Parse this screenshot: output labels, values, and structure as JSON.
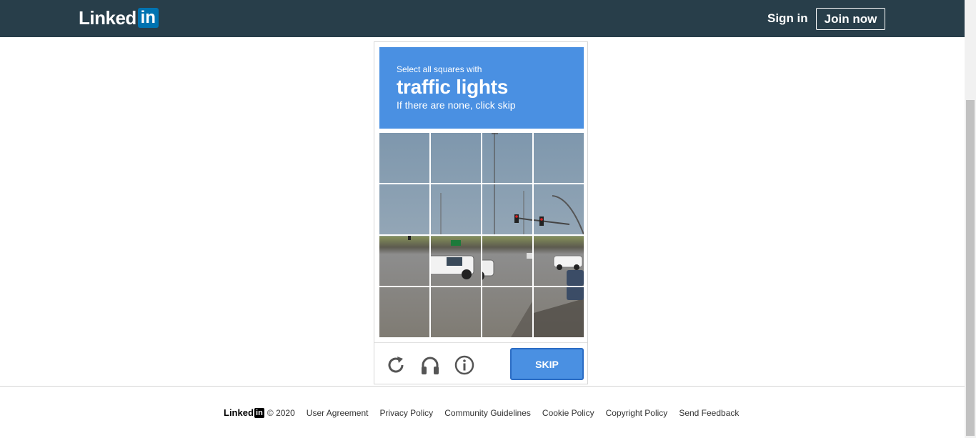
{
  "header": {
    "logo_text": "Linked",
    "logo_in": "in",
    "sign_in": "Sign in",
    "join_now": "Join now"
  },
  "captcha": {
    "instruction_line1": "Select all squares with",
    "target": "traffic lights",
    "instruction_line3": "If there are none, click skip",
    "skip_label": "SKIP",
    "icons": [
      "reload-icon",
      "audio-headphones-icon",
      "info-icon"
    ],
    "grid_rows": 4,
    "grid_cols": 4
  },
  "footer": {
    "logo_text": "Linked",
    "logo_in": "in",
    "copyright": "© 2020",
    "links": [
      "User Agreement",
      "Privacy Policy",
      "Community Guidelines",
      "Cookie Policy",
      "Copyright Policy",
      "Send Feedback"
    ]
  },
  "colors": {
    "header_bg": "#283e4a",
    "brand_blue": "#0073b1",
    "captcha_blue": "#4a90e2"
  }
}
